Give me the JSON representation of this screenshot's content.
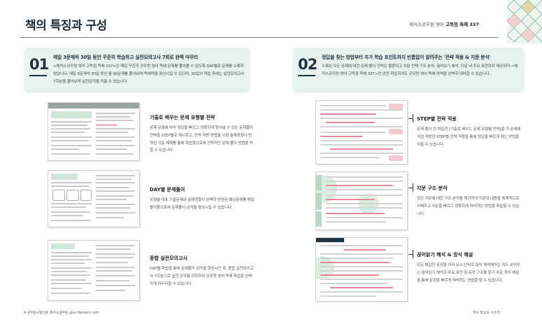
{
  "header": {
    "title": "책의 특징과 구성",
    "subtitle_prefix": "해커스공무원 영어 ",
    "subtitle_bold": "고득점 독해 337"
  },
  "intro": [
    {
      "num": "01",
      "title": "매일 3문제씩 30일 동안 꾸준히 학습하고 실전모의고사 7회로 완벽 마무리",
      "body": "<해커스공무원 영어 고득점 독해 337>은 매일 꾸준히 공무원 영어 독해 문제를 풀어볼 수 있도록 DAY별로 문제를 수록하였습니다. 매일 3문제씩 30일 동안 총 90문제를 풀어보며 독해력을 향상시킬 수 있으며, 30일의 학습 후에는 실전모의고사 7회분을 풀어보며 실전감각을 키울 수 있습니다."
    },
    {
      "num": "02",
      "title": "정답을 찾는 방법부터 추가 학습 포인트까지 빈틈없이 알려주는 '전략 적용 & 지문 분석'",
      "body": "수록된 모든 문제에 대한 문제 풀이 전략은 물론이고 지문 전체 구조 분석, 끊어읽기 해석, 지문 내 주요 표현까지 제공되어 <해커스공무원 영어 고득점 독해 337>만 완전 학습하여도 공무원 영어 독해 영역을 완벽히 대비할 수 있습니다."
    }
  ],
  "left_features": [
    {
      "title": "기출로 배우는 문제 유형별 전략",
      "body": "문제 유형에 따라 정답을 빠르고 정확하게 찾아낼 수 있는 문제풀이 전략을 STEP별로 제시하고, 전략 적용 방법을 시험 출제경향이 반영된 기출 예제를 통해 학습함으로써 전략적인 문제 풀이 방법을 익힐 수 있습니다."
    },
    {
      "title": "DAY별 문제풀이",
      "body": "유형별 대표 기출문제와 출제경향이 완벽히 반영된 예상문제를 매일 풀어봄으로써 문제풀이 감각을 향상시킬 수 있습니다."
    },
    {
      "title": "종합 실전모의고사",
      "body": "DAY별 학습을 통해 문제풀이 감각을 향상시킨 후, 종합 실전모의고사 7회분으로 실전 감각을 강화하여 공무원 영어 독해 학습을 완벽하게 마무리할 수 있습니다."
    }
  ],
  "right_features": [
    {
      "title": "STEP별 전략 적용",
      "body": "문제 풀이 전 학습한 [기출로 배우는 문제 유형별 전략]을 각 문제에 직접 적용한 STEP별 전략 적용을 통해 정답을 빠르게 찾는 방법을 익힐 수 있습니다."
    },
    {
      "title": "지문 구조 분석",
      "body": "모든 지문에 대한 구조 분석을 제공하여 지문의 내용을 체계적으로 이해하고 지문을 빠르고 정확하게 파악하는 방법을 학습할 수 있습니다."
    },
    {
      "title": "끊어읽기 해석 & 정식 해설",
      "body": "모든 복잡한 문장을 의미 요소 단위로 끊어 해석해주는 지도 보여주는 끊어읽기 해석과 주요 표현 및 문장 구조를 알기 쉬운 정식 해설을 통해 문장을 빠르게 해석하는 연습을 할 수 있습니다."
    }
  ],
  "footer": {
    "left": "4 공무원시험전문 해커스공무원 gosi.Hackers.com",
    "right": "책의 특징과 구성  5"
  },
  "colors": {
    "mint_box": "#e9f3ee",
    "navy": "#1e3440",
    "pink_highlight": "#f2b8c4"
  }
}
